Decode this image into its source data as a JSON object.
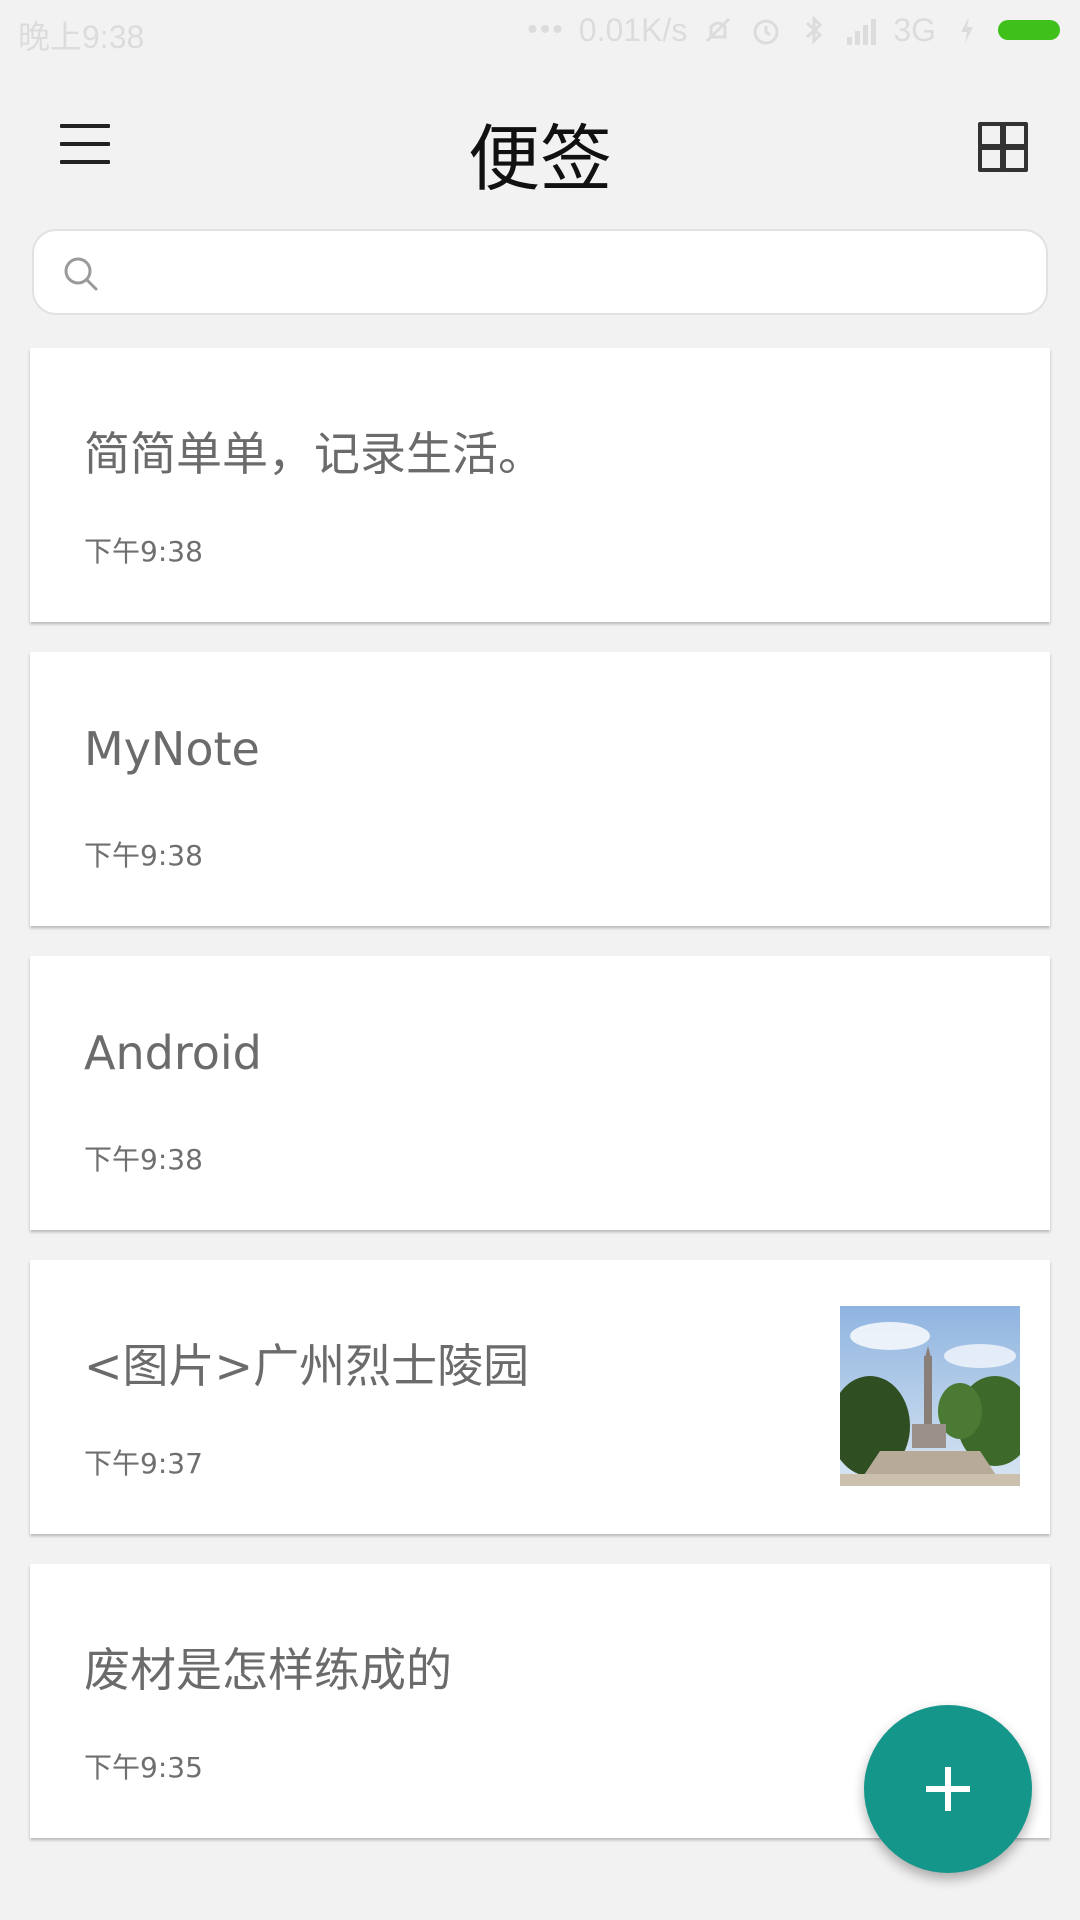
{
  "status_bar": {
    "time": "晚上9:38",
    "speed": "0.01K/s",
    "network": "3G",
    "battery_color": "#3fc01b"
  },
  "app_bar": {
    "title": "便签",
    "menu_icon": "hamburger-menu-icon",
    "view_toggle_icon": "grid-view-icon"
  },
  "search": {
    "placeholder": "",
    "value": ""
  },
  "notes": [
    {
      "title": "简简单单，记录生活。",
      "time": "下午9:38"
    },
    {
      "title": "MyNote",
      "time": "下午9:38"
    },
    {
      "title": "Android",
      "time": "下午9:38"
    },
    {
      "title": "<图片>广州烈士陵园",
      "time": "下午9:37",
      "thumbnail": "memorial-photo"
    },
    {
      "title": "废材是怎样练成的",
      "time": "下午9:35"
    }
  ],
  "fab": {
    "icon": "plus-icon",
    "color": "#14978a"
  }
}
